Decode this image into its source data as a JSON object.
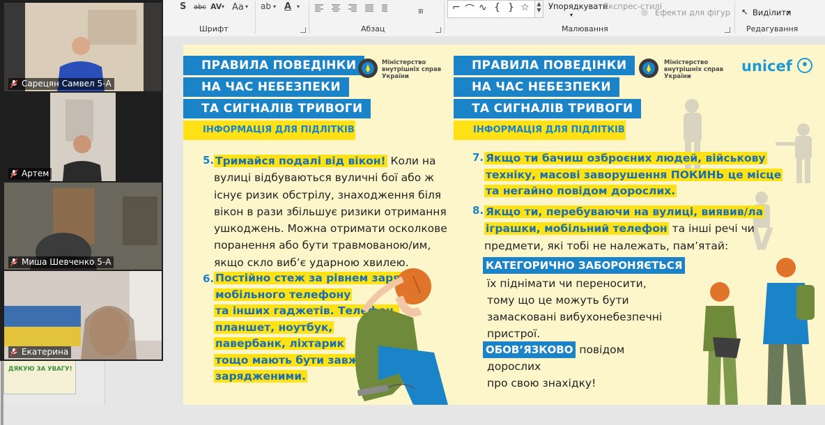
{
  "ribbon": {
    "font_group": "Шрифт",
    "paragraph_group": "Абзац",
    "drawing_group": "Малювання",
    "editing_group": "Редагування",
    "arrange_label": "Упорядкувати",
    "quick_styles_label": "Експрес-стилі",
    "shape_effects_label": "Ефекти для фігур",
    "select_label": "Виділити",
    "font_size_label": "Aa",
    "strike_label": "abc",
    "spacing_label": "AV",
    "shape_glyphs": [
      "⌐",
      "⌒",
      "∿",
      "{",
      "}",
      "☆"
    ]
  },
  "participants": [
    {
      "name": "Сарецян Самвел 5-А"
    },
    {
      "name": "Артем"
    },
    {
      "name": "Миша Шевченко 5-А"
    },
    {
      "name": "Екатерина"
    }
  ],
  "left_slide_thumb": {
    "text": "ДЯКУЮ ЗА УВАГУ!"
  },
  "slide": {
    "left": {
      "title_lines": [
        "ПРАВИЛА ПОВЕДІНКИ",
        "НА ЧАС НЕБЕЗПЕКИ",
        "ТА СИГНАЛІВ ТРИВОГИ"
      ],
      "subtitle": "ІНФОРМАЦІЯ ДЛЯ ПІДЛІТКІВ",
      "ministry_lines": [
        "Міністерство",
        "внутрішніх справ",
        "України"
      ],
      "item5": {
        "number": "5.",
        "lead": "Тримайся подалі від вікон!",
        "first_line_rest": " Коли на",
        "lines": [
          "вулиці відбуваються вуличні бої або ж",
          "існує ризик обстрілу, знаходження біля",
          "вікон в рази збільшує ризики отримання",
          "ушкоджень. Можна отримати осколкове",
          "поранення або бути травмованою/им,",
          "якщо скло виб’є ударною хвилею."
        ]
      },
      "item6": {
        "number": "6.",
        "lines": [
          "Постійно стеж за рівнем заряду",
          "мобільного телефону",
          "та інших гаджетів. Телефон,",
          "планшет, ноутбук,",
          "павербанк, ліхтарик",
          "тощо мають бути завжди",
          "зарядженими."
        ]
      }
    },
    "right": {
      "title_lines": [
        "ПРАВИЛА ПОВЕДІНКИ",
        "НА ЧАС НЕБЕЗПЕКИ",
        "ТА СИГНАЛІВ ТРИВОГИ"
      ],
      "subtitle": "ІНФОРМАЦІЯ ДЛЯ ПІДЛІТКІВ",
      "ministry_lines": [
        "Міністерство",
        "внутрішніх справ",
        "України"
      ],
      "unicef": "unicef",
      "item7": {
        "number": "7.",
        "lines": [
          "Якщо ти бачиш озброєних людей, військову",
          "техніку, масові заворушення ПОКИНЬ це місце",
          "та негайно повідом дорослих."
        ]
      },
      "item8": {
        "number": "8.",
        "hl_lines": [
          "Якщо ти, перебуваючи на вулиці, виявив/ла",
          "іграшки, мобільний телефон"
        ],
        "line2_rest": " та інші речі чи",
        "line3": "предмети, які тобі не належать, пам’ятай:"
      },
      "forbidden_tag": "КАТЕГОРИЧНО ЗАБОРОНЯЄТЬСЯ",
      "forbidden_lines": [
        "їх піднімати чи переносити,",
        "тому що це можуть бути",
        "замасковані вибухонебезпечні",
        "пристрої."
      ],
      "must_tag": "ОБОВ’ЯЗКОВО",
      "must_rest": " повідом",
      "must_lines": [
        "дорослих",
        "про свою знахідку!"
      ]
    }
  },
  "colors": {
    "blue": "#1b84c9",
    "yellow": "#ffe216",
    "slide_bg": "#fdf6cb"
  }
}
